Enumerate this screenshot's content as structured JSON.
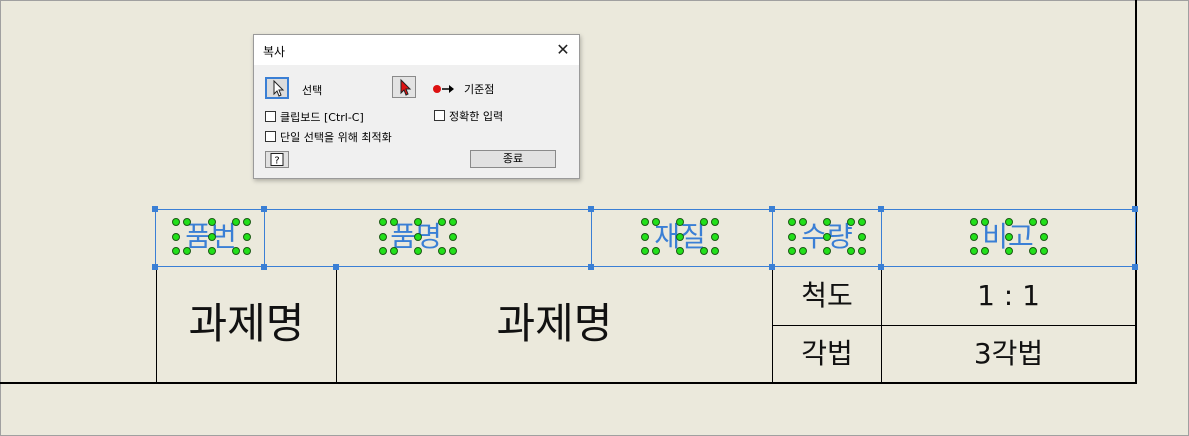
{
  "dialog": {
    "title": "복사",
    "select_label": "선택",
    "basepoint_label": "기준점",
    "clipboard_label": "클립보드 [Ctrl-C]",
    "precise_input_label": "정확한 입력",
    "optimize_label": "단일 선택을 위해 최적화",
    "close_button_label": "종료",
    "close_glyph": "✕",
    "help_glyph": "?",
    "clipboard_checked": false,
    "precise_input_checked": false,
    "optimize_checked": false
  },
  "table": {
    "headers": {
      "part_no": "품번",
      "part_name": "품명",
      "material": "재질",
      "quantity": "수량",
      "remarks": "비고"
    },
    "project_label": "과제명",
    "project_name": "과제명",
    "scale_label": "척도",
    "scale_value": "1 : 1",
    "projection_label": "각법",
    "projection_value": "3각법"
  },
  "colors": {
    "selection": "#3a7fd5",
    "grip": "#22e01a",
    "background": "#ebe9dc"
  }
}
